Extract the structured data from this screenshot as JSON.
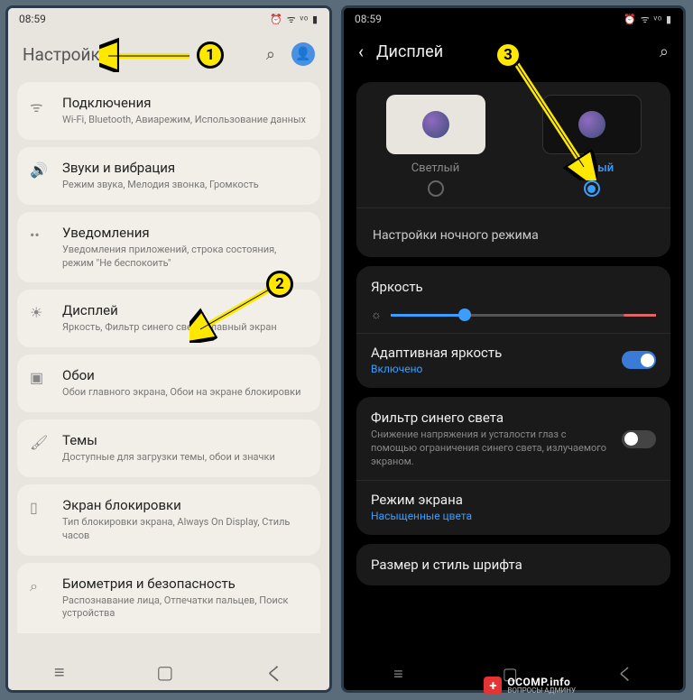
{
  "annotations": {
    "m1": "1",
    "m2": "2",
    "m3": "3"
  },
  "status": {
    "time": "08:59",
    "icons": "⏰ ᯤ ᵛᵒ ▮"
  },
  "left": {
    "title": "Настройки",
    "items": [
      {
        "icon": "ᯤ",
        "title": "Подключения",
        "sub": "Wi-Fi, Bluetooth, Авиарежим, Использование данных"
      },
      {
        "icon": "🔊",
        "title": "Звуки и вибрация",
        "sub": "Режим звука, Мелодия звонка, Громкость"
      },
      {
        "icon": "••",
        "title": "Уведомления",
        "sub": "Уведомления приложений, строка состояния, режим \"Не беспокоить\""
      },
      {
        "icon": "☀",
        "title": "Дисплей",
        "sub": "Яркость, Фильтр синего света, Главный экран"
      },
      {
        "icon": "▣",
        "title": "Обои",
        "sub": "Обои главного экрана, Обои на экране блокировки"
      },
      {
        "icon": "🖌",
        "title": "Темы",
        "sub": "Доступные для загрузки темы, обои и значки"
      },
      {
        "icon": "▯",
        "title": "Экран блокировки",
        "sub": "Тип блокировки экрана, Always On Display, Стиль часов"
      },
      {
        "icon": "⌕",
        "title": "Биометрия и безопасность",
        "sub": "Распознавание лица, Отпечатки пальцев, Поиск устройства"
      }
    ]
  },
  "right": {
    "title": "Дисплей",
    "theme_light": "Светлый",
    "theme_dark": "Темный",
    "night_mode": "Настройки ночного режима",
    "brightness": "Яркость",
    "adaptive": {
      "title": "Адаптивная яркость",
      "state": "Включено"
    },
    "bluefilter": {
      "title": "Фильтр синего света",
      "sub": "Снижение напряжения и усталости глаз с помощью ограничения синего света, излучаемого экраном."
    },
    "screenmode": {
      "title": "Режим экрана",
      "value": "Насыщенные цвета"
    },
    "fontsize": "Размер и стиль шрифта"
  },
  "watermark": {
    "main": "OCOMP.info",
    "sub": "ВОПРОСЫ АДМИНУ"
  }
}
